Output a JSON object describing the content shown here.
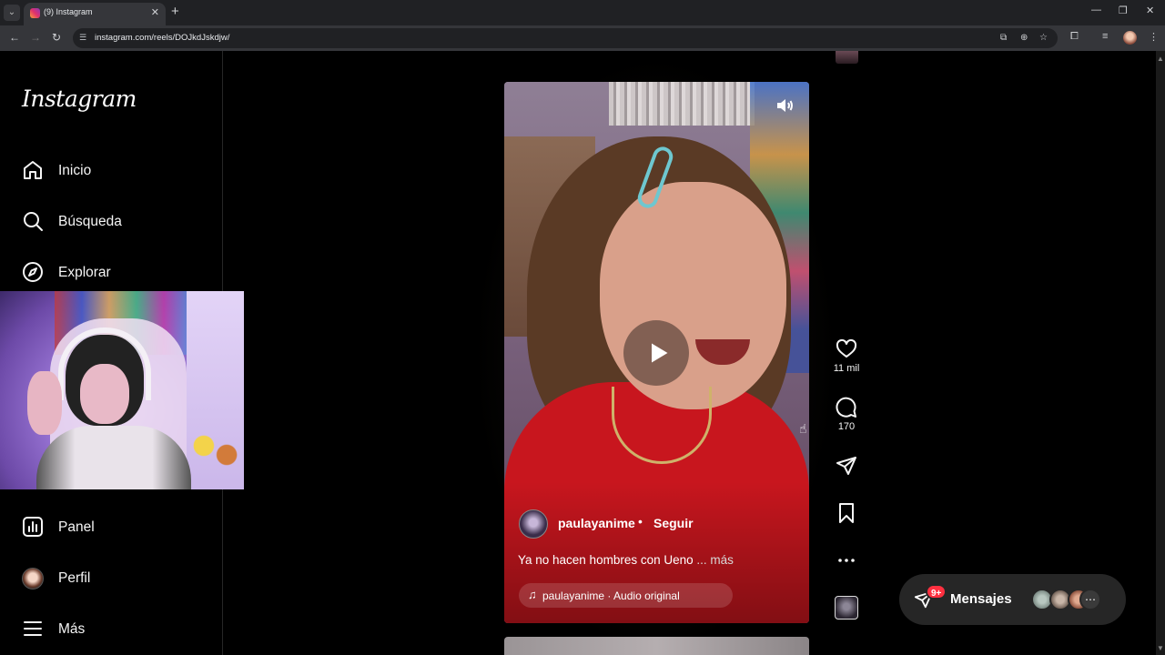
{
  "browser": {
    "tab_title": "(9) Instagram",
    "url": "instagram.com/reels/DOJkdJskdjw/",
    "new_tab_glyph": "+",
    "close_glyph": "✕",
    "win_min": "—",
    "win_max": "❐",
    "win_close": "✕"
  },
  "sidebar": {
    "logo": "Instagram",
    "items": [
      {
        "label": "Inicio",
        "icon": "home-icon"
      },
      {
        "label": "Búsqueda",
        "icon": "search-icon"
      },
      {
        "label": "Explorar",
        "icon": "compass-icon"
      },
      {
        "label": "Panel",
        "icon": "dashboard-icon"
      },
      {
        "label": "Perfil",
        "icon": "avatar"
      },
      {
        "label": "Más",
        "icon": "menu-icon"
      }
    ]
  },
  "reel": {
    "author": "paulayanime",
    "separator": "•",
    "follow_label": "Seguir",
    "caption": "Ya no hacen hombres con Ueno",
    "caption_more": " ... más",
    "audio": "paulayanime · Audio original",
    "audio_glyph": "♫"
  },
  "actions": {
    "likes": "11 mil",
    "comments": "170"
  },
  "messages": {
    "label": "Mensajes",
    "badge": "9+",
    "more_glyph": "⋯"
  },
  "colors": {
    "accent_badge": "#ff3040",
    "background": "#000000",
    "shirt_red": "#c8161e"
  }
}
